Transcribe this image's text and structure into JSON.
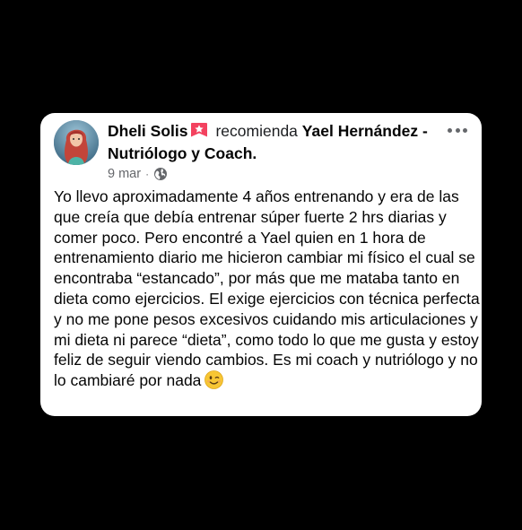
{
  "post": {
    "author": "Dheli Solis",
    "action": "recomienda",
    "page_name": "Yael Hernández - Nutriólogo y Coach.",
    "date": "9 mar",
    "separator": "·",
    "privacy_icon": "globe-icon",
    "more_icon": "more-options-icon",
    "badge_icon": "recommend-star-icon",
    "text": "Yo llevo aproximadamente 4 años entrenando y era de las que creía que debía entrenar súper fuerte 2 hrs diarias y comer poco. Pero encontré a Yael quien en 1 hora de entrenamiento diario me hicieron cambiar mi físico el cual se encontraba “estancado”, por más que me mataba tanto en dieta como ejercicios. El exige ejercicios con técnica perfecta y no me pone pesos excesivos cuidando mis articulaciones y mi dieta ni parece “dieta”, como todo lo que me gusta y estoy feliz de seguir viendo cambios. Es mi coach y nutriólogo y no lo cambiaré por nada",
    "emoji_icon": "winking-face-emoji"
  },
  "colors": {
    "background": "#000000",
    "card": "#ffffff",
    "text": "#050505",
    "meta": "#65676b",
    "badge": "#f3425f"
  }
}
